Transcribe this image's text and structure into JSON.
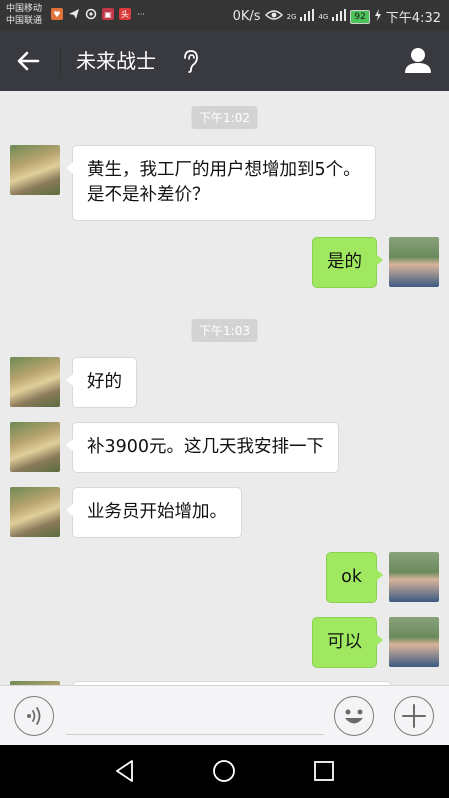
{
  "status_bar": {
    "carrier1": "中国移动",
    "carrier2": "中国联通",
    "net_speed": "0K/s",
    "signal1": "2G",
    "signal2": "4G",
    "battery": "92",
    "time": "下午4:32"
  },
  "header": {
    "title": "未来战士"
  },
  "messages": [
    {
      "type": "time",
      "text": "下午1:02"
    },
    {
      "type": "received",
      "text_line1": "黄生，我工厂的用户想增加到5个。",
      "text_line2": "是不是补差价？"
    },
    {
      "type": "sent",
      "text": "是的"
    },
    {
      "type": "time",
      "text": "下午1:03"
    },
    {
      "type": "received",
      "text": "好的"
    },
    {
      "type": "received",
      "text": "补3900元。这几天我安排一下"
    },
    {
      "type": "received",
      "text": "业务员开始增加。"
    },
    {
      "type": "sent",
      "text": "ok"
    },
    {
      "type": "sent",
      "text": "可以"
    }
  ],
  "icons": {
    "back": "arrow-left-icon",
    "ear": "ear-icon",
    "profile": "person-icon",
    "voice": "voice-icon",
    "emoji": "emoji-icon",
    "plus": "plus-icon"
  },
  "colors": {
    "header_bg": "#393a3f",
    "chat_bg": "#ebebeb",
    "sent_bubble": "#9fe85f",
    "received_bubble": "#ffffff"
  }
}
